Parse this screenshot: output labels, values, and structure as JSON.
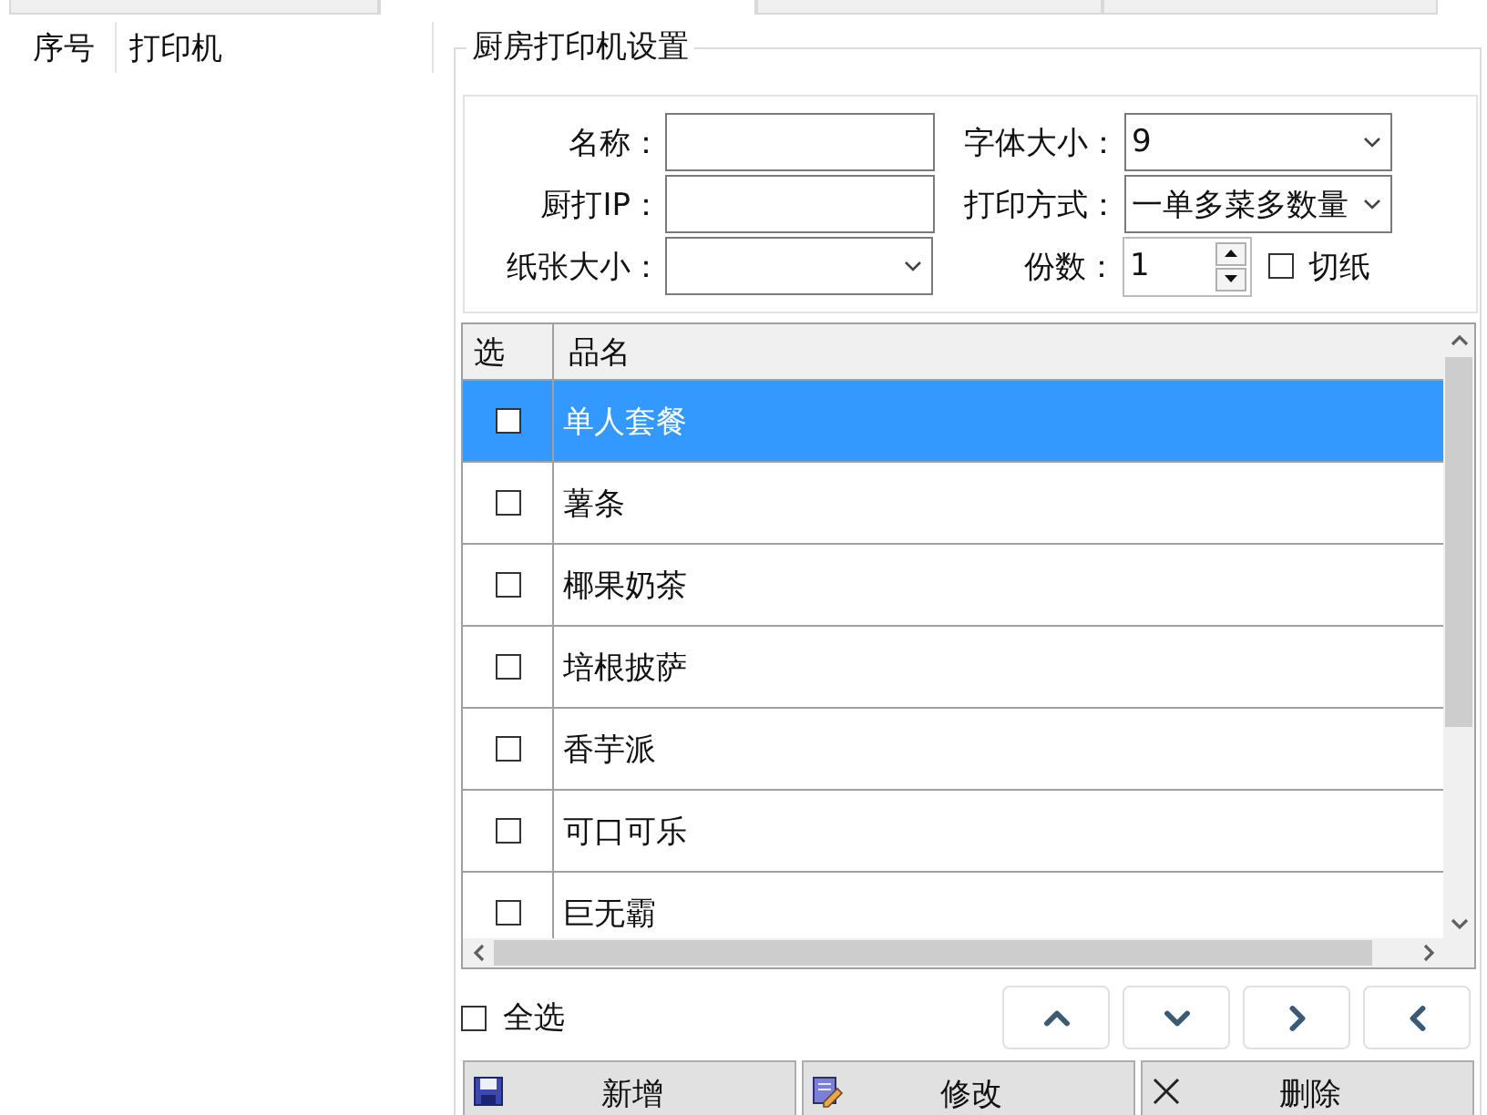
{
  "top_tabs": [
    {
      "selected": false
    },
    {
      "selected": true
    },
    {
      "selected": false
    },
    {
      "selected": false
    }
  ],
  "printer_list": {
    "columns": [
      "序号",
      "打印机"
    ]
  },
  "settings": {
    "title": "厨房打印机设置",
    "form_rows": [
      [
        {
          "kind": "text",
          "label": "名称："
        },
        {
          "kind": "select",
          "label": "字体大小：",
          "value": "9"
        }
      ],
      [
        {
          "kind": "text",
          "label": "厨打IP："
        },
        {
          "kind": "select",
          "label": "打印方式：",
          "value": "一单多菜多数量"
        }
      ],
      [
        {
          "kind": "select",
          "label": "纸张大小："
        },
        {
          "kind": "spin",
          "label": "份数：",
          "value": "1"
        },
        {
          "kind": "checkbox",
          "label": "切纸",
          "checked": false
        }
      ]
    ],
    "table": {
      "columns": [
        "选",
        "品名"
      ],
      "rows": [
        {
          "checked": false,
          "name": "单人套餐",
          "selected": true
        },
        {
          "checked": false,
          "name": "薯条",
          "selected": false
        },
        {
          "checked": false,
          "name": "椰果奶茶",
          "selected": false
        },
        {
          "checked": false,
          "name": "培根披萨",
          "selected": false
        },
        {
          "checked": false,
          "name": "香芋派",
          "selected": false
        },
        {
          "checked": false,
          "name": "可口可乐",
          "selected": false
        },
        {
          "checked": false,
          "name": "巨无霸",
          "selected": false
        }
      ]
    },
    "select_all": {
      "label": "全选",
      "checked": false
    },
    "nav_buttons": [
      {
        "kind": "up"
      },
      {
        "kind": "down"
      },
      {
        "kind": "right"
      },
      {
        "kind": "left"
      }
    ],
    "action_buttons": [
      {
        "kind": "add",
        "label": "新增"
      },
      {
        "kind": "edit",
        "label": "修改"
      },
      {
        "kind": "delete",
        "label": "删除"
      }
    ]
  }
}
